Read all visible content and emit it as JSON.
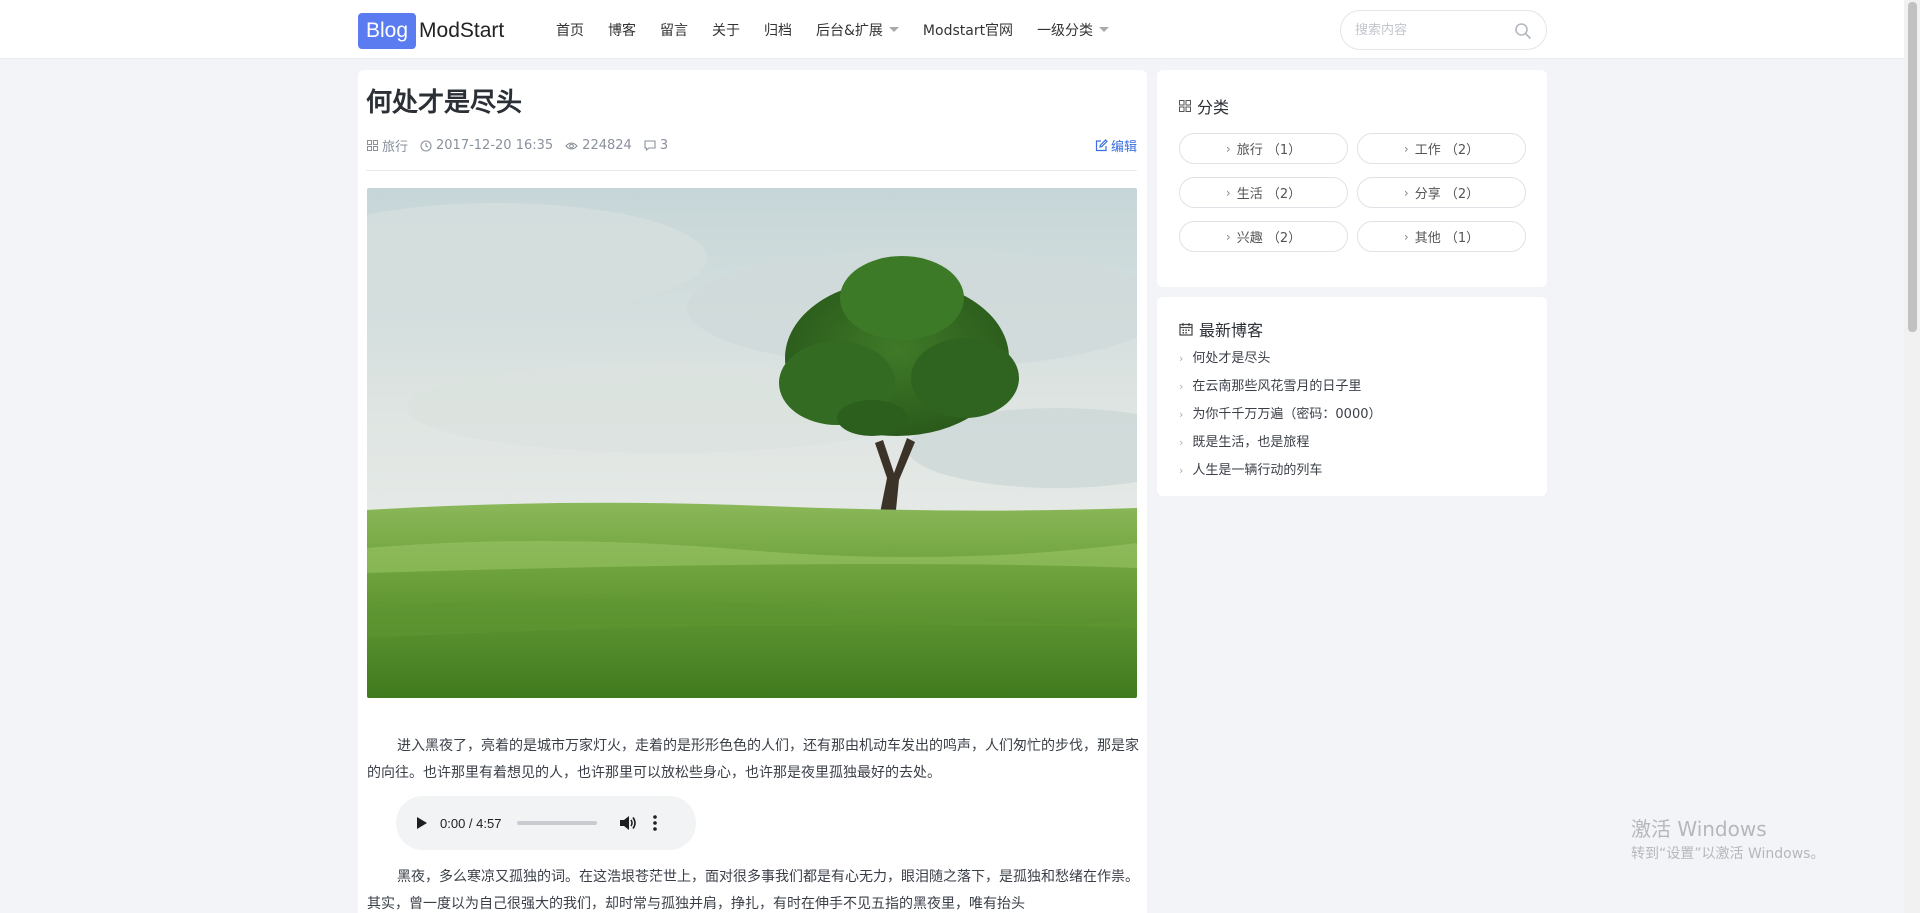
{
  "header": {
    "logo_blog": "Blog",
    "logo_name": "ModStart",
    "nav": [
      {
        "label": "首页"
      },
      {
        "label": "博客"
      },
      {
        "label": "留言"
      },
      {
        "label": "关于"
      },
      {
        "label": "归档"
      },
      {
        "label": "后台&扩展",
        "dropdown": true
      },
      {
        "label": "Modstart官网"
      },
      {
        "label": "一级分类",
        "dropdown": true
      }
    ],
    "search_placeholder": "搜索内容",
    "search_icon": "search-icon"
  },
  "article": {
    "title": "何处才是尽头",
    "category": "旅行",
    "datetime": "2017-12-20 16:35",
    "views": "224824",
    "comments": "3",
    "edit_label": "编辑",
    "paragraph1": "进入黑夜了，亮着的是城市万家灯火，走着的是形形色色的人们，还有那由机动车发出的鸣声，人们匆忙的步伐，那是家的向往。也许那里有着想见的人，也许那里可以放松些身心，也许那是夜里孤独最好的去处。",
    "audio": {
      "time": "0:00 / 4:57"
    },
    "paragraph2": "黑夜，多么寒凉又孤独的词。在这浩垠苍茫世上，面对很多事我们都是有心无力，眼泪随之落下，是孤独和愁绪在作祟。其实，曾一度以为自己很强大的我们，却时常与孤独并肩，挣扎，有时在伸手不见五指的黑夜里，唯有抬头"
  },
  "sidebar": {
    "categories_title": "分类",
    "categories": [
      {
        "label": "旅行 （1）"
      },
      {
        "label": "工作 （2）"
      },
      {
        "label": "生活 （2）"
      },
      {
        "label": "分享 （2）"
      },
      {
        "label": "兴趣 （2）"
      },
      {
        "label": "其他 （1）"
      }
    ],
    "recent_title": "最新博客",
    "recent": [
      {
        "label": "何处才是尽头"
      },
      {
        "label": "在云南那些风花雪月的日子里"
      },
      {
        "label": "为你千千万万遍（密码：0000）"
      },
      {
        "label": "既是生活，也是旅程"
      },
      {
        "label": "人生是一辆行动的列车"
      }
    ]
  },
  "watermark": {
    "line1": "激活 Windows",
    "line2": "转到“设置”以激活 Windows。"
  },
  "colors": {
    "accent": "#5b7cf0",
    "link": "#3b6fe0",
    "page_bg": "#f3f4f7"
  }
}
